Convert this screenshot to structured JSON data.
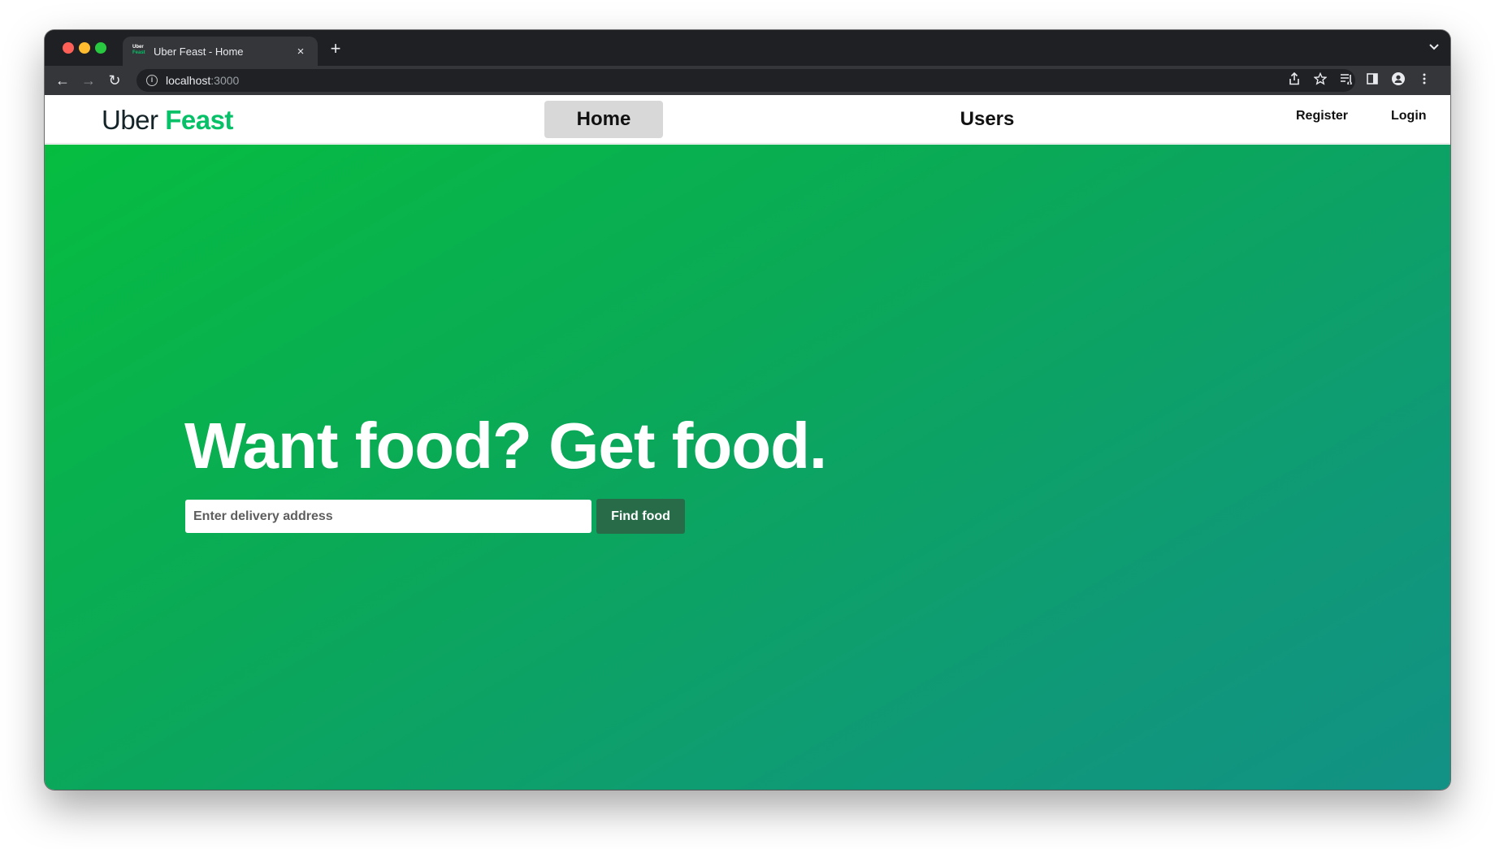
{
  "browser": {
    "tab": {
      "title": "Uber Feast - Home",
      "favicon_text": [
        "Uber",
        "Feast"
      ],
      "close_glyph": "×"
    },
    "new_tab_glyph": "+",
    "tab_menu_glyph": "⌄",
    "toolbar": {
      "back_glyph": "←",
      "forward_glyph": "→",
      "reload_glyph": "↻",
      "info_glyph": "i",
      "url_host": "localhost",
      "url_port": ":3000",
      "icons": [
        "share-icon",
        "bookmark-star-icon",
        "reading-list-icon",
        "side-panel-icon",
        "profile-icon",
        "more-menu-icon"
      ]
    }
  },
  "site": {
    "logo": {
      "part1": "Uber",
      "part2": "Feast"
    },
    "nav": {
      "home": "Home",
      "users": "Users",
      "register": "Register",
      "login": "Login"
    },
    "hero": {
      "headline": "Want food? Get food.",
      "address_placeholder": "Enter delivery address",
      "find_button": "Find food"
    }
  },
  "colors": {
    "brand_green": "#06c167",
    "hero_gradient_start": "#06bd40",
    "hero_gradient_end": "#129185",
    "find_button_bg": "#276b48",
    "active_nav_bg": "#d8d8d8"
  }
}
